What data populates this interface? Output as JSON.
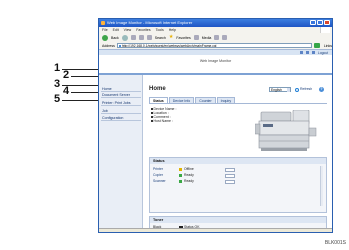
{
  "browser": {
    "title": "Web Image Monitor - Microsoft Internet Explorer",
    "menu": [
      "File",
      "Edit",
      "View",
      "Favorites",
      "Tools",
      "Help"
    ],
    "toolbar": {
      "back": "Back",
      "search": "Search",
      "favorites": "Favorites",
      "media": "Media"
    },
    "address_label": "Address",
    "address": "http://192.168.0.1/web/guest/en/websys/webArch/mainFrame.cgi",
    "links_label": "Links",
    "topbar": [
      "Logout"
    ]
  },
  "header": {
    "title": "Web Image Monitor"
  },
  "sidebar": {
    "items": [
      {
        "label": "Home"
      },
      {
        "label": "Document Server"
      },
      {
        "label": "Printer: Print Jobs"
      },
      {
        "label": "Job"
      },
      {
        "label": "Configuration"
      }
    ]
  },
  "main": {
    "title": "Home",
    "language": "English",
    "refresh_label": "Refresh",
    "help_label": "?",
    "tabs": [
      "Status",
      "Device Info",
      "Counter",
      "Inquiry"
    ],
    "info": [
      "Device Name :",
      "Location :",
      "Comment :",
      "Host Name :"
    ],
    "status_heading": "Status",
    "status_rows": [
      {
        "label": "Printer",
        "value": "Offline",
        "icon": "warning"
      },
      {
        "label": "Copier",
        "value": "Ready",
        "icon": "ok"
      },
      {
        "label": "Scanner",
        "value": "Ready",
        "icon": "ok"
      }
    ],
    "toner_heading": "Toner",
    "toner_rows": [
      {
        "label": "Black",
        "value": "Status OK"
      }
    ]
  },
  "callouts": [
    "1",
    "2",
    "3",
    "4",
    "5"
  ],
  "image_code": "BLK001S"
}
